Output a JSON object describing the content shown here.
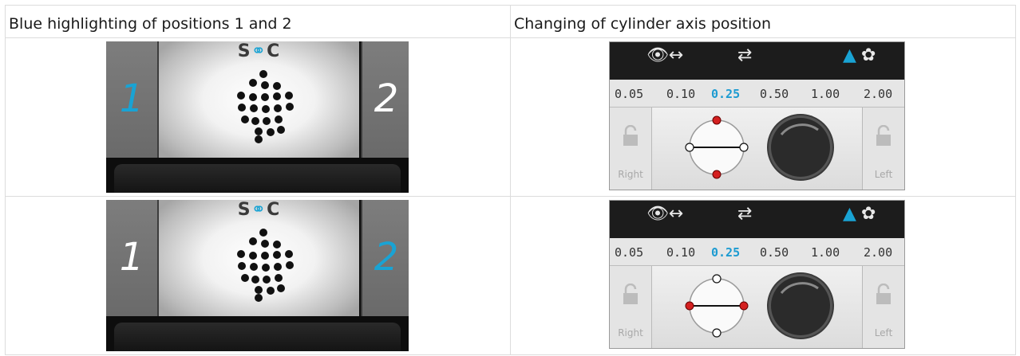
{
  "header": {
    "col1": "Blue highlighting of positions 1 and 2",
    "col2": "Changing of cylinder axis position"
  },
  "projector": {
    "logo_left": "S",
    "logo_right": "C",
    "label_1": "1",
    "label_2": "2",
    "rows": [
      {
        "highlighted_position": "1"
      },
      {
        "highlighted_position": "2"
      }
    ]
  },
  "cylinder": {
    "scale_values": [
      "0.05",
      "0.10",
      "0.25",
      "0.50",
      "1.00",
      "2.00"
    ],
    "selected_value": "0.25",
    "lock_left_label": "Right",
    "lock_right_label": "Left",
    "rows": [
      {
        "axis_orientation": "horizontal"
      },
      {
        "axis_orientation": "vertical"
      }
    ]
  },
  "colors": {
    "highlight": "#19a3d4",
    "axis_marker": "#d42020"
  }
}
